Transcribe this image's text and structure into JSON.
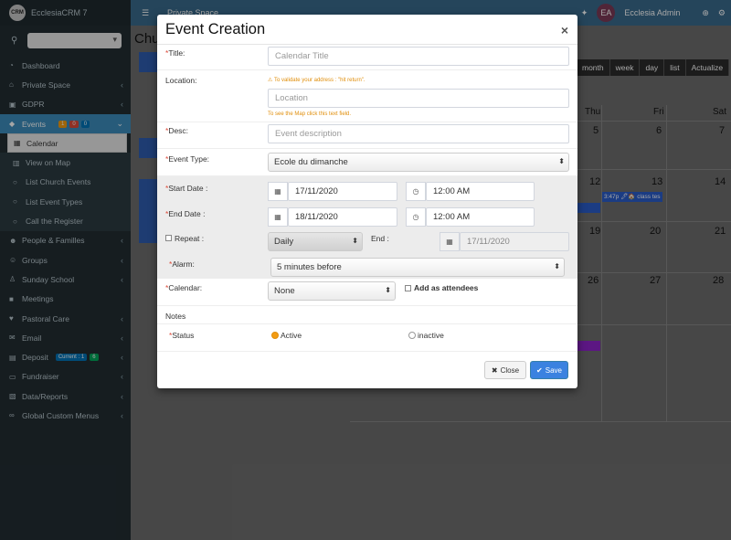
{
  "app": {
    "brand": "EcclesiaCRM 7",
    "logo_text": "CRM"
  },
  "topbar": {
    "private_space": "Private Space",
    "user_initials": "EA",
    "user_name": "Ecclesia Admin"
  },
  "sidebar": {
    "items": [
      {
        "label": "Dashboard",
        "icon": "dashboard-icon"
      },
      {
        "label": "Private Space",
        "icon": "home-icon"
      },
      {
        "label": "GDPR",
        "icon": "lock-icon"
      },
      {
        "label": "Events",
        "icon": "ticket-icon",
        "badges": [
          "1",
          "0",
          "0"
        ]
      },
      {
        "label": "Calendar",
        "icon": "calendar-icon"
      },
      {
        "label": "View on Map",
        "icon": "map-icon"
      },
      {
        "label": "List Church Events",
        "icon": "circle-icon"
      },
      {
        "label": "List Event Types",
        "icon": "circle-icon"
      },
      {
        "label": "Call the Register",
        "icon": "circle-icon"
      },
      {
        "label": "People & Familles",
        "icon": "people-icon"
      },
      {
        "label": "Groups",
        "icon": "group-icon"
      },
      {
        "label": "Sunday School",
        "icon": "child-icon"
      },
      {
        "label": "Meetings",
        "icon": "video-icon"
      },
      {
        "label": "Pastoral Care",
        "icon": "heart-icon"
      },
      {
        "label": "Email",
        "icon": "envelope-icon"
      },
      {
        "label": "Deposit",
        "icon": "bank-icon",
        "badges": [
          "Current : 1",
          "6"
        ]
      },
      {
        "label": "Fundraiser",
        "icon": "money-icon"
      },
      {
        "label": "Data/Reports",
        "icon": "report-icon"
      },
      {
        "label": "Global Custom Menus",
        "icon": "link-icon"
      }
    ]
  },
  "page": {
    "title": "Chu"
  },
  "calendar": {
    "views": [
      "month",
      "week",
      "day",
      "list",
      "Actualize"
    ],
    "day_headers": [
      "Thu",
      "Fri",
      "Sat"
    ],
    "day_numbers": [
      "5",
      "6",
      "7",
      "12",
      "13",
      "14",
      "19",
      "20",
      "21",
      "26",
      "27",
      "28"
    ],
    "event_label": "3:47p 🖊🏠 class tes"
  },
  "modal": {
    "title": "Event Creation",
    "close_symbol": "×",
    "title_label": "Title:",
    "title_placeholder": "Calendar Title",
    "location_label": "Location:",
    "location_note": "To validate your address : \"hit return\".",
    "location_placeholder": "Location",
    "location_map_note": "To see the Map click this text field.",
    "desc_label": "Desc:",
    "desc_placeholder": "Event description",
    "event_type_label": "Event Type:",
    "event_type_value": "Ecole du dimanche",
    "start_date_label": "Start Date :",
    "start_date": "17/11/2020",
    "start_time": "12:00 AM",
    "end_date_label": "End Date :",
    "end_date": "18/11/2020",
    "end_time": "12:00 AM",
    "repeat_label": "Repeat :",
    "repeat_value": "Daily",
    "end_label": "End :",
    "end_repeat_date": "17/11/2020",
    "alarm_label": "Alarm:",
    "alarm_value": "5 minutes before",
    "calendar_label": "Calendar:",
    "calendar_value": "None",
    "add_attendees": "Add as attendees",
    "notes_label": "Notes",
    "status_label": "Status",
    "status_active": "Active",
    "status_inactive": "inactive",
    "close_button": "Close",
    "save_button": "Save",
    "required_mark": "*"
  }
}
